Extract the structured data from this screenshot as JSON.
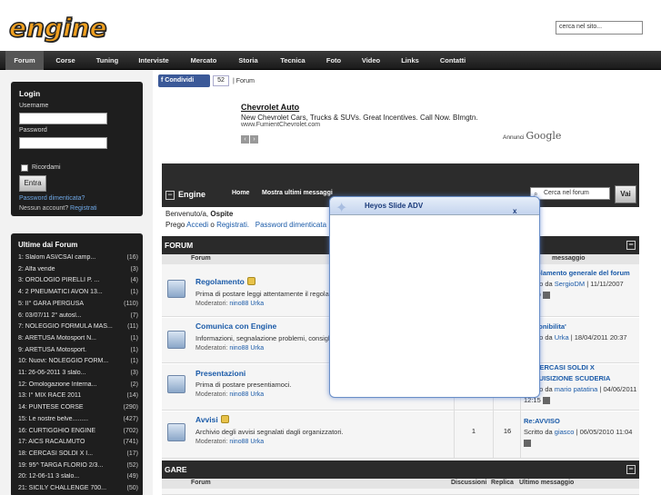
{
  "header": {
    "logo_text": "engine",
    "search_placeholder": "cerca nel sito..."
  },
  "topnav": {
    "items": [
      "Forum",
      "Corse",
      "Tuning",
      "Interviste",
      "Mercato",
      "Storia",
      "Tecnica",
      "Foto",
      "Video",
      "Links",
      "Contatti"
    ],
    "active": "Forum"
  },
  "login": {
    "title": "Login",
    "username_label": "Username",
    "password_label": "Password",
    "remember_label": "Ricordami",
    "submit_label": "Entra",
    "forgot_link": "Password dimenticata?",
    "no_account_text": "Nessun account?",
    "register_link": "Registrati"
  },
  "recent": {
    "title": "Ultime dai Forum",
    "items": [
      {
        "text": "1: Slalom ASI/CSAI camp...",
        "count": "(16)"
      },
      {
        "text": "2: Alfa vende",
        "count": "(3)"
      },
      {
        "text": "3: OROLOGIO PIRELLI P. ...",
        "count": "(4)"
      },
      {
        "text": "4: 2 PNEUMATICI AVON 13...",
        "count": "(1)"
      },
      {
        "text": "5: II° GARA PERGUSA",
        "count": "(110)"
      },
      {
        "text": "6: 03/07/11 2° autosl...",
        "count": "(7)"
      },
      {
        "text": "7: NOLEGGIO FORMULA MAS...",
        "count": "(11)"
      },
      {
        "text": "8: ARETUSA Motosport N...",
        "count": "(1)"
      },
      {
        "text": "9: ARETUSA Motosport.",
        "count": "(1)"
      },
      {
        "text": "10: Nuovi: NOLEGGIO FORM...",
        "count": "(1)"
      },
      {
        "text": "11: 26-06-2011 3 slalo...",
        "count": "(3)"
      },
      {
        "text": "12: Omologazione Interna...",
        "count": "(2)"
      },
      {
        "text": "13: I° MIX RACE 2011",
        "count": "(14)"
      },
      {
        "text": "14: PUNTESE CORSE",
        "count": "(290)"
      },
      {
        "text": "15: Le nostre belve.........",
        "count": "(427)"
      },
      {
        "text": "16: CURTIGGHIO ENGINE",
        "count": "(702)"
      },
      {
        "text": "17: AICS RACALMUTO",
        "count": "(741)"
      },
      {
        "text": "18: CERCASI SOLDI X I...",
        "count": "(17)"
      },
      {
        "text": "19: 95^ TARGA FLORIO 2/3...",
        "count": "(52)"
      },
      {
        "text": "20: 12-06-11 3 slalo...",
        "count": "(49)"
      },
      {
        "text": "21: SICILY CHALLENGE 700...",
        "count": "(50)"
      }
    ]
  },
  "share": {
    "fb_label": "Condividi",
    "fb_count": "52",
    "crumb": "| Forum"
  },
  "ad": {
    "title": "Chevrolet Auto",
    "text": "New Chevrolet Cars, Trucks & SUVs. Great Incentives. Call Now. BImgtn.",
    "url": "www.FumientChevrolet.com",
    "annunci": "Annunci",
    "google": "Google"
  },
  "forumbar": {
    "name": "Engine",
    "nav_home": "Home",
    "nav_latest": "Mostra ultimi messaggi",
    "search_placeholder": "Cerca nel forum",
    "go_label": "Vai"
  },
  "welcome": {
    "line1_prefix": "Benvenuto/a,",
    "guest": "Ospite",
    "line2_prefix": "Prego",
    "login_link": "Accedi",
    "or": "o",
    "register_link": "Registrati.",
    "forgot_link": "Password dimenticata"
  },
  "sections": {
    "forum": "FORUM",
    "gare": "GARE"
  },
  "columns": {
    "forum": "Forum",
    "discussions": "Discussioni",
    "replies": "Replica",
    "last": "Ultimo messaggio",
    "last_short": "messaggio"
  },
  "forums": [
    {
      "title": "Regolamento",
      "desc": "Prima di postare leggi attentamente il regolamento",
      "mods_label": "Moderatori:",
      "mods": [
        "nino88",
        "Urka"
      ],
      "last_title": "Regolamento generale del forum",
      "last_by": "Scritto da",
      "last_user": "SergioDM",
      "last_date": "| 11/11/2007 12:10"
    },
    {
      "title": "Comunica con Engine",
      "desc": "Informazioni, segnalazione problemi, consigli...",
      "mods_label": "Moderatori:",
      "mods": [
        "nino88",
        "Urka"
      ],
      "last_title": "Disponibilita'",
      "last_by": "Scritto da",
      "last_user": "Urka",
      "last_date": "| 18/04/2011 20:37"
    },
    {
      "title": "Presentazioni",
      "desc": "Prima di postare presentiamoci.",
      "mods_label": "Moderatori:",
      "mods": [
        "nino88",
        "Urka"
      ],
      "last_title": "Re:CERCASI SOLDI X ACQUISIZIONE SCUDERIA",
      "last_by": "Scritto da",
      "last_user": "mario patatina",
      "last_date": "| 04/06/2011 12:15"
    },
    {
      "title": "Avvisi",
      "desc": "Archivio degli avvisi segnalati dagli organizzatori.",
      "mods_label": "Moderatori:",
      "mods": [
        "nino88",
        "Urka"
      ],
      "discussions": "1",
      "replies": "16",
      "last_title": "Re:AVVISO",
      "last_by": "Scritto da",
      "last_user": "giasco",
      "last_date": "| 06/05/2010 11:04"
    }
  ],
  "popup": {
    "title": "Heyos Slide ADV",
    "close": "x"
  }
}
